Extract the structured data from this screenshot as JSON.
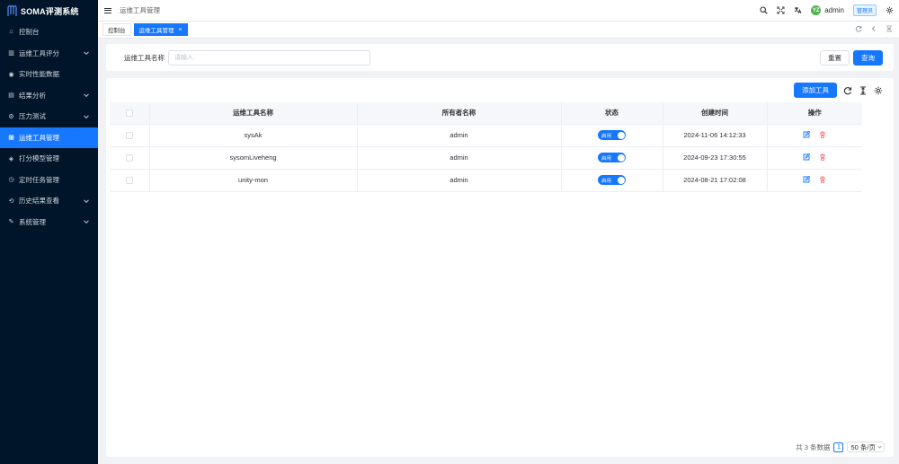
{
  "app": {
    "title": "SOMA评测系统"
  },
  "colors": {
    "sidebar_bg": "#001529",
    "accent": "#1677ff",
    "danger": "#f56c6c"
  },
  "sidebar": {
    "items": [
      {
        "label": "控制台",
        "icon": "dashboard-icon",
        "expandable": false,
        "active": false
      },
      {
        "label": "运维工具评分",
        "icon": "score-icon",
        "expandable": true,
        "active": false
      },
      {
        "label": "实时性能数据",
        "icon": "realtime-icon",
        "expandable": false,
        "active": false
      },
      {
        "label": "结果分析",
        "icon": "analysis-icon",
        "expandable": true,
        "active": false
      },
      {
        "label": "压力测试",
        "icon": "pressure-icon",
        "expandable": true,
        "active": false
      },
      {
        "label": "运维工具管理",
        "icon": "tool-icon",
        "expandable": false,
        "active": true
      },
      {
        "label": "打分模型管理",
        "icon": "model-icon",
        "expandable": false,
        "active": false
      },
      {
        "label": "定时任务管理",
        "icon": "clock-icon",
        "expandable": false,
        "active": false
      },
      {
        "label": "历史结果查看",
        "icon": "history-icon",
        "expandable": true,
        "active": false
      },
      {
        "label": "系统管理",
        "icon": "settings-icon",
        "expandable": true,
        "active": false
      }
    ]
  },
  "header": {
    "breadcrumb": "运维工具管理",
    "username": "admin",
    "avatar_text": "YZ",
    "role": "管理员",
    "icons": [
      "search-icon",
      "fullscreen-icon",
      "translate-icon",
      "gear-icon"
    ]
  },
  "tabs": [
    {
      "label": "控制台",
      "active": false
    },
    {
      "label": "运维工具管理",
      "active": true,
      "close": "×"
    }
  ],
  "search": {
    "label": "运维工具名称",
    "placeholder": "请输入",
    "value": "",
    "reset_label": "重置",
    "query_label": "查询"
  },
  "toolbar": {
    "add_label": "添加工具"
  },
  "table": {
    "columns": [
      "运维工具名称",
      "所有者名称",
      "状态",
      "创建时间",
      "操作"
    ],
    "rows": [
      {
        "name": "sysAk",
        "owner": "admin",
        "status": "启用",
        "created": "2024-11-06 14:12:33"
      },
      {
        "name": "sysomLiveheng",
        "owner": "admin",
        "status": "启用",
        "created": "2024-09-23 17:30:55"
      },
      {
        "name": "unity-mon",
        "owner": "admin",
        "status": "启用",
        "created": "2024-08-21 17:02:08"
      }
    ]
  },
  "pagination": {
    "total_text": "共 3 条数据",
    "current_page": "1",
    "page_size": "50 条/页"
  }
}
